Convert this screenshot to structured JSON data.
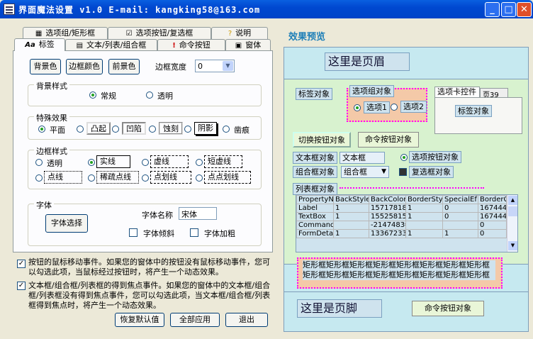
{
  "window": {
    "title": "界面魔法设置 v1.0   E-mail: kangking58@163.com"
  },
  "tabs": {
    "row1": [
      {
        "label": "选项组/矩形框",
        "icon": "grid-icon"
      },
      {
        "label": "选项按钮/复选框",
        "icon": "check-icon"
      },
      {
        "label": "说明",
        "icon": "question-icon"
      }
    ],
    "row2": [
      {
        "label": "标签",
        "icon": "text-aa-icon"
      },
      {
        "label": "文本/列表/组合框",
        "icon": "listbox-icon"
      },
      {
        "label": "命令按钮",
        "icon": "exclaim-icon"
      },
      {
        "label": "窗体",
        "icon": "form-icon"
      }
    ]
  },
  "panel": {
    "bg_color_btn": "背景色",
    "border_color_btn": "边框颜色",
    "fore_color_btn": "前景色",
    "border_width_label": "边框宽度",
    "border_width_value": "0",
    "bg_style": {
      "title": "背景样式",
      "options": [
        "常规",
        "透明"
      ]
    },
    "effect": {
      "title": "特殊效果",
      "options": [
        "平面",
        "凸起",
        "凹陷",
        "蚀刻",
        "阴影",
        "凿痕"
      ]
    },
    "border_style": {
      "title": "边框样式",
      "options": [
        "透明",
        "实线",
        "虚线",
        "短虚线",
        "点线",
        "稀疏点线",
        "点划线",
        "点点划线"
      ]
    },
    "font": {
      "title": "字体",
      "choose_btn": "字体选择",
      "name_label": "字体名称",
      "name_value": "宋体",
      "italic": "字体倾斜",
      "bold": "字体加粗"
    }
  },
  "options": {
    "hover": "按钮的鼠标移动事件。如果您的窗体中的按钮没有鼠标移动事件，您可以勾选此项，当鼠标经过按钮时，将产生一个动态效果。",
    "focus": "文本框/组合框/列表框的得到焦点事件。如果您的窗体中的文本框/组合框/列表框没有得到焦点事件，您可以勾选此项，当文本框/组合框/列表框得到焦点时，将产生一个动态效果。"
  },
  "footer": {
    "restore": "恢复默认值",
    "apply_all": "全部应用",
    "exit": "退出"
  },
  "preview": {
    "title": "效果预览",
    "header": "这里是页眉",
    "footer": "这里是页脚",
    "label_obj": "标签对象",
    "option_group": "选项组对象",
    "opt1": "选项1",
    "opt2": "选项2",
    "tab_ctl": "选项卡控件",
    "tab_page": "页39",
    "tab_label": "标签对象",
    "toggle": "切换按钮对象",
    "cmd": "命令按钮对象",
    "textbox_obj": "文本框对象",
    "textbox": "文本框",
    "option_btn": "选项按钮对象",
    "combo_obj": "组合框对象",
    "combo": "组合框",
    "checkbox": "复选框对象",
    "list_obj": "列表框对象",
    "list_headers": [
      "PropertyN",
      "BackStyle",
      "BackColor",
      "BorderSty",
      "SpecialEf",
      "BorderC"
    ],
    "list_rows": [
      [
        "Label",
        "1",
        "15717818",
        "1",
        "0",
        "1674444"
      ],
      [
        "TextBox",
        "1",
        "15525815",
        "1",
        "0",
        "1674444"
      ],
      [
        "CommandBu",
        "",
        "-2147483€",
        "",
        "",
        "0"
      ],
      [
        "FormDetai",
        "1",
        "13367233",
        "1",
        "1",
        "0"
      ]
    ],
    "rect_text": "矩形框矩形框矩形框矩形框矩形框矩形框矩形框矩形框矩形框矩形框矩形框矩形框矩形框矩形框矩形框矩形框",
    "footer_cmd": "命令按钮对象"
  }
}
